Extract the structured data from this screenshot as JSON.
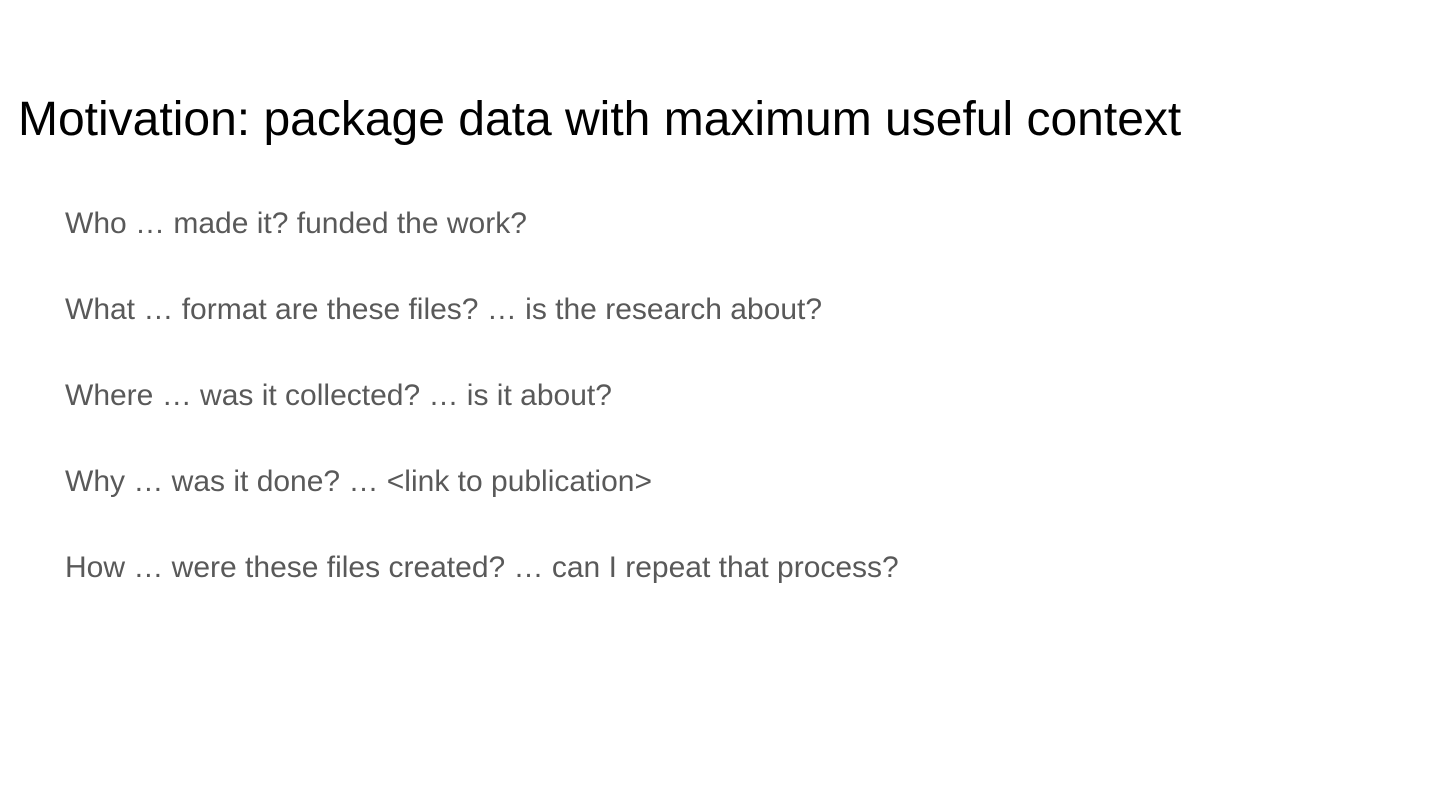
{
  "slide": {
    "title": "Motivation: package data with maximum useful context",
    "bullets": [
      "Who …  made it? funded the work?",
      "What … format are these files? … is the research about?",
      "Where … was it collected? … is it about?",
      "Why … was it done?  … <link to publication>",
      "How … were these files created? … can I repeat that process?"
    ]
  }
}
